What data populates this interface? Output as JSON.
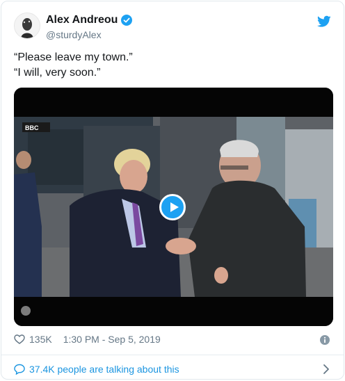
{
  "tweet": {
    "author_name": "Alex Andreou",
    "author_handle": "@sturdyAlex",
    "text_lines": [
      "“Please leave my town.”",
      "“I will, very soon.”"
    ],
    "likes": "135K",
    "timestamp": "1:30 PM - Sep 5, 2019",
    "conversation_label": "37.4K people are talking about this"
  },
  "media": {
    "type": "video",
    "overlay_text": "BBC",
    "play_icon": "play-icon"
  },
  "icons": {
    "verified": "verified-badge-icon",
    "brand": "twitter-bird-icon",
    "like": "heart-icon",
    "info": "info-icon",
    "conversation": "speech-bubble-icon",
    "expand": "chevron-right-icon"
  },
  "colors": {
    "accent": "#1da1f2",
    "link": "#1b95e0",
    "muted": "#657786",
    "text": "#14171a"
  }
}
